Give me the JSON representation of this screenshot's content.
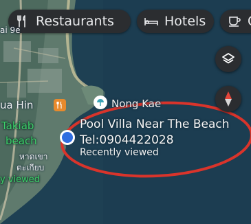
{
  "chips": {
    "restaurants": {
      "label": "Restaurants",
      "icon": "fork-knife-icon"
    },
    "hotels": {
      "label": "Hotels",
      "icon": "bed-icon"
    },
    "coffee": {
      "label": "C",
      "icon": "coffee-cup-icon"
    }
  },
  "map_buttons": {
    "layers": {
      "icon": "layers-icon"
    },
    "compass": {
      "icon": "compass-icon"
    }
  },
  "map_labels": {
    "city_partial": "ai 9e",
    "hua_hin": "ua Hin",
    "takiab": "Takiab",
    "beach": "beach",
    "thai_line1": "หาดเขา",
    "thai_line2": "ตะเกียบ",
    "recently_viewed_left": "y viewed",
    "nong_kae": "Nong Kae"
  },
  "selected_place": {
    "title": "Pool Villa Near The Beach Tel:0904422028",
    "subtitle": "Recently viewed"
  },
  "colors": {
    "sea": "#1d3f52",
    "land": "#6f8a7c",
    "highlight": "#d9342b",
    "pin": "#2f6ee0",
    "poi_green": "#3ecf6a"
  }
}
